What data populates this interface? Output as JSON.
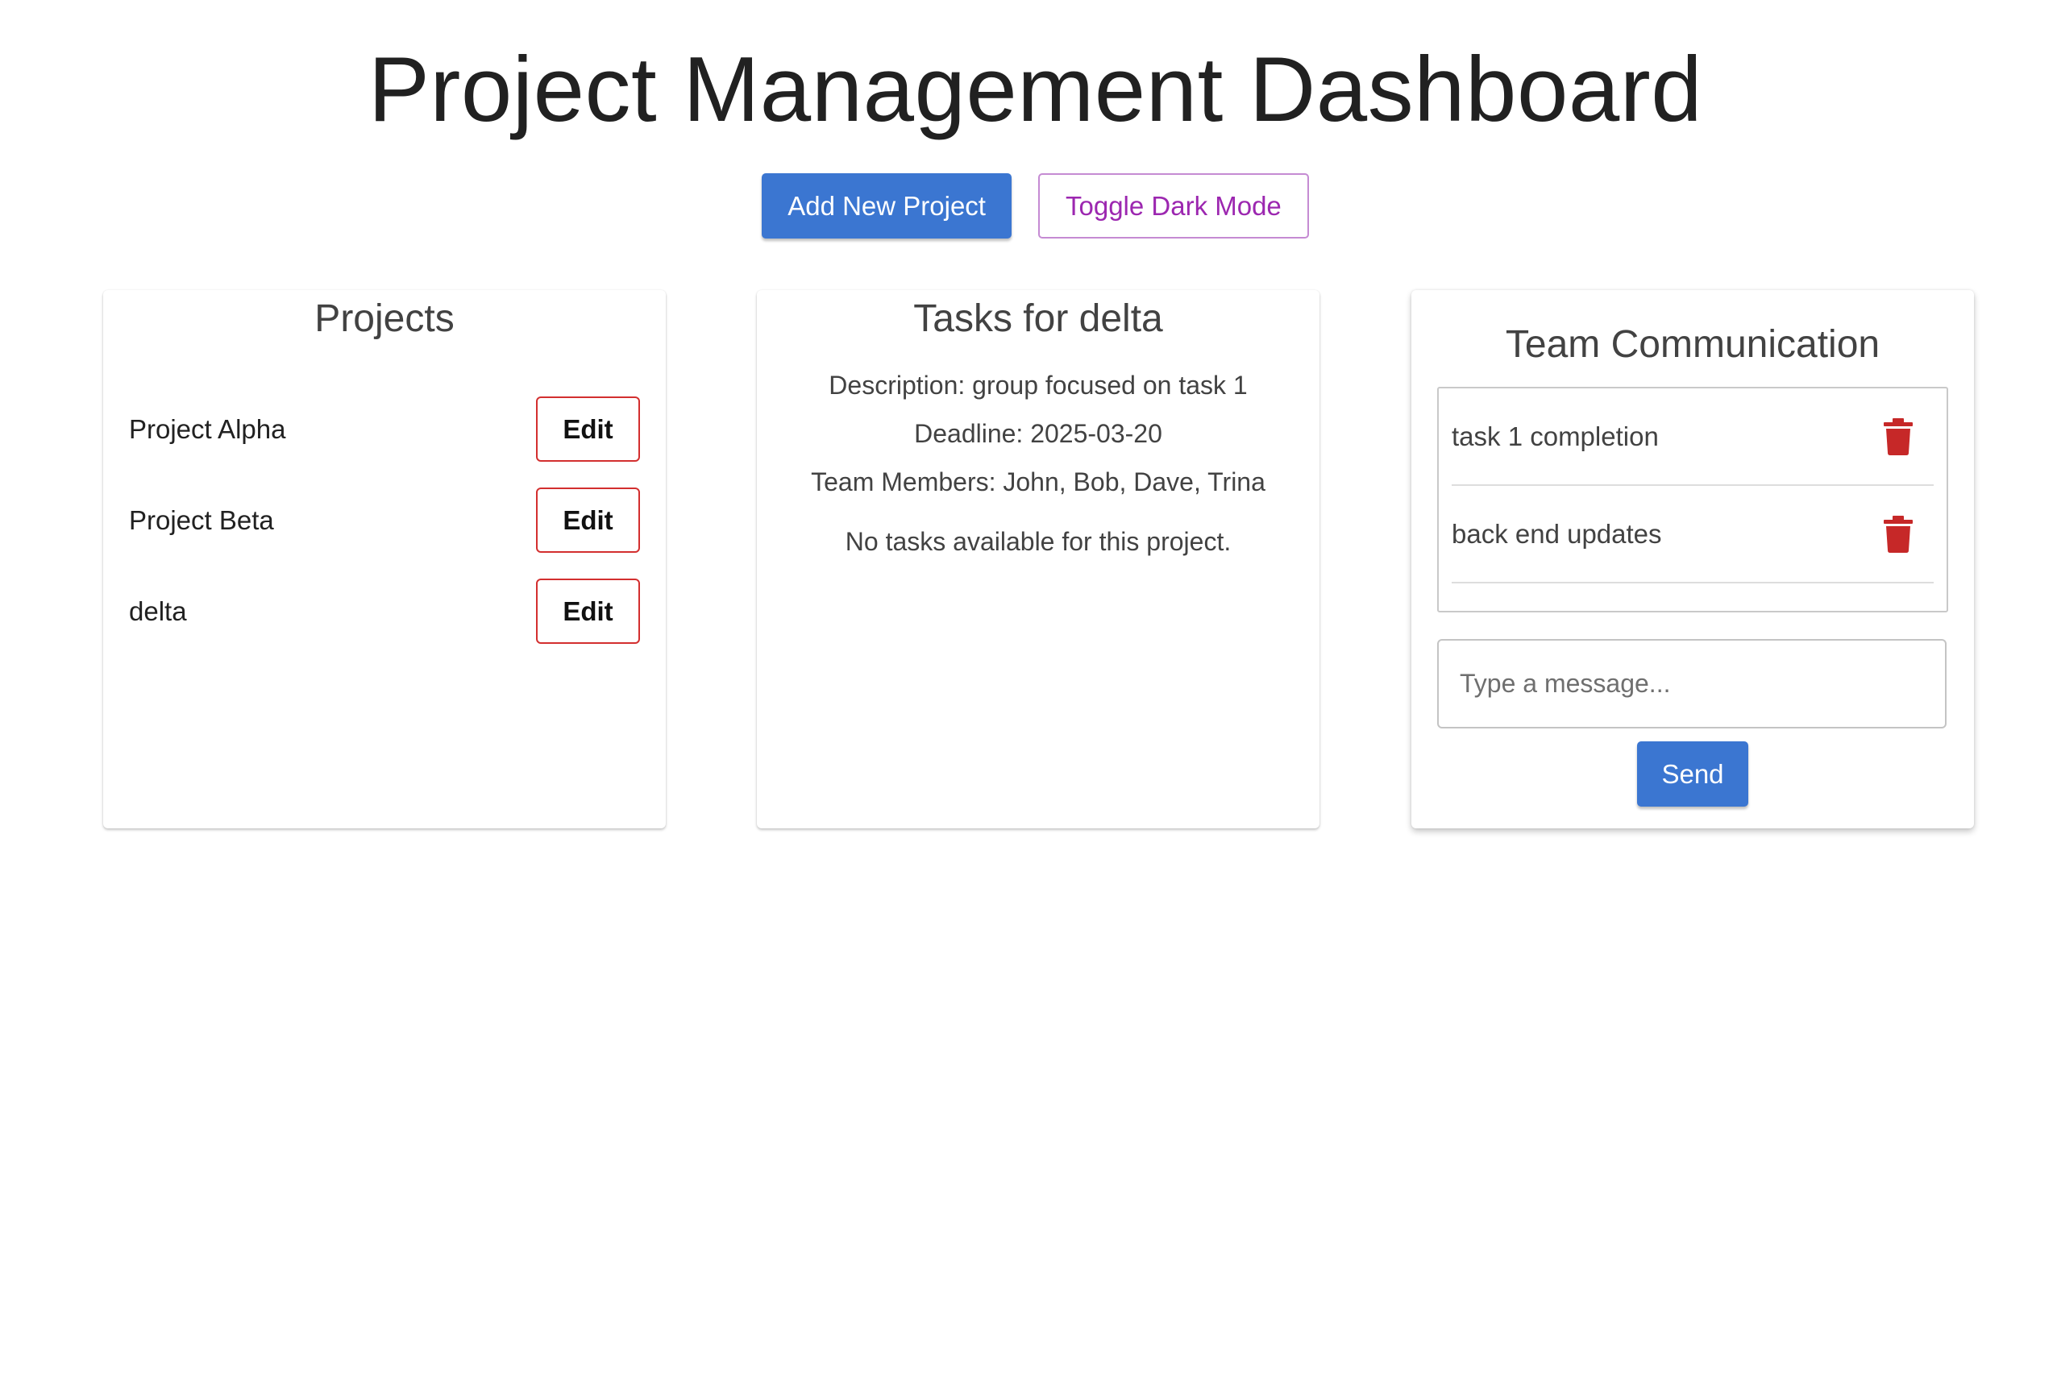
{
  "header": {
    "title": "Project Management Dashboard",
    "add_project_label": "Add New Project",
    "toggle_dark_label": "Toggle Dark Mode"
  },
  "projects": {
    "title": "Projects",
    "edit_label": "Edit",
    "items": [
      {
        "name": "Project Alpha"
      },
      {
        "name": "Project Beta"
      },
      {
        "name": "delta"
      }
    ]
  },
  "tasks": {
    "title": "Tasks for delta",
    "description": "Description: group focused on task 1",
    "deadline": "Deadline: 2025-03-20",
    "team_members": "Team Members: John, Bob, Dave, Trina",
    "empty_message": "No tasks available for this project."
  },
  "communication": {
    "title": "Team Communication",
    "messages": [
      {
        "text": "task 1 completion",
        "icon": "trash-icon"
      },
      {
        "text": "back end updates",
        "icon": "trash-icon"
      }
    ],
    "input_placeholder": "Type a message...",
    "input_value": "",
    "send_label": "Send"
  },
  "colors": {
    "primary": "#3b76d1",
    "secondary": "#9c27b0",
    "danger": "#d32f2f",
    "delete_icon": "#c62828"
  }
}
